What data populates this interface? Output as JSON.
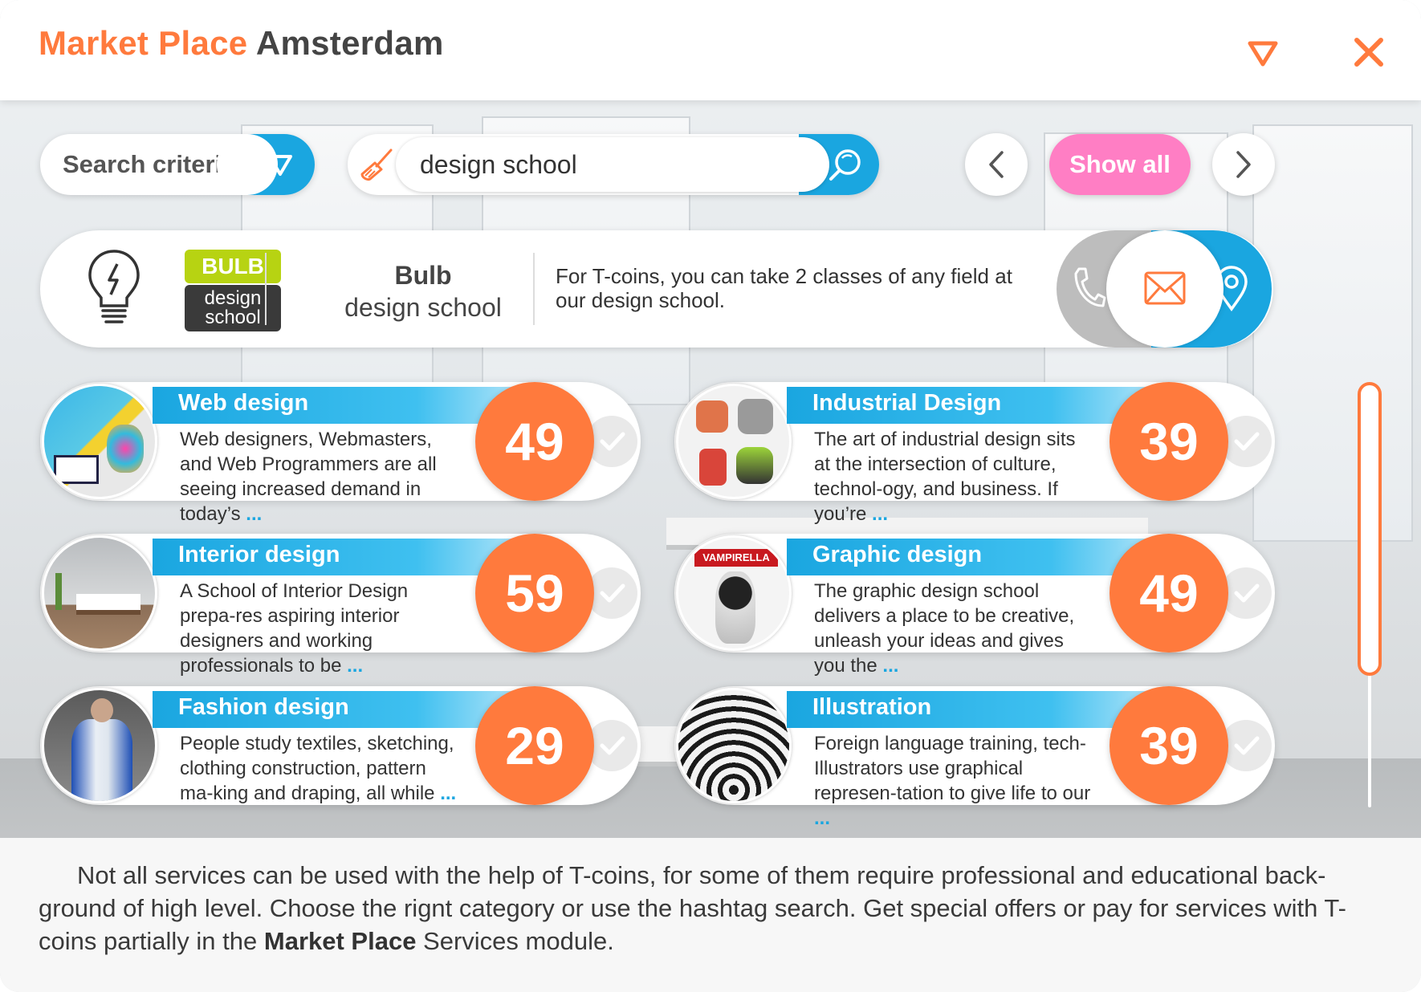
{
  "header": {
    "title_accent": "Market Place",
    "title_city": "Amsterdam",
    "icons": [
      "dropdown-triangle-icon",
      "close-icon"
    ]
  },
  "search": {
    "criteria_label": "Search criteria",
    "query": "design school",
    "show_all_label": "Show all"
  },
  "provider": {
    "logo_top": "BULB",
    "logo_bottom_1": "design",
    "logo_bottom_2": "school",
    "name_bold": "Bulb",
    "name": "design school",
    "description": "For T-coins, you can take 2 classes of any field at our design school."
  },
  "services": [
    {
      "title": "Web design",
      "text": "Web designers, Webmasters, and Web Programmers are all seeing increased demand in today’s",
      "more": "...",
      "price": "49"
    },
    {
      "title": "Industrial Design",
      "text": "The art of industrial design sits at the intersection of culture, technol-ogy, and business. If you’re",
      "more": "...",
      "price": "39"
    },
    {
      "title": "Interior design",
      "text": "A School of Interior Design prepa-res aspiring interior designers and working professionals to be",
      "more": "...",
      "price": "59"
    },
    {
      "title": "Graphic design",
      "text": "The graphic design school delivers a place to be creative, unleash your ideas and gives you the",
      "more": "...",
      "price": "49"
    },
    {
      "title": "Fashion design",
      "text": "People study textiles, sketching, clothing construction, pattern ma-king and draping, all while",
      "more": "...",
      "price": "29"
    },
    {
      "title": "Illustration",
      "text": "Foreign language training, tech-Illustrators use graphical represen-tation to give life to our",
      "more": "...",
      "price": "39"
    }
  ],
  "thumb_labels": {
    "graphic": "VAMPIRELLA"
  },
  "footer": {
    "text_before": "Not all services can be used with the help of T-coins, for some of them require professional and educational back-ground of high level. Choose the rignt category or use the hashtag search. Get special offers or pay for services with T-coins partially in the ",
    "text_bold": "Market Place",
    "text_after": " Services module."
  },
  "colors": {
    "accent": "#ff7a3d",
    "blue": "#1aa6e0",
    "pink": "#ff7ec4",
    "lime": "#b7d312"
  }
}
